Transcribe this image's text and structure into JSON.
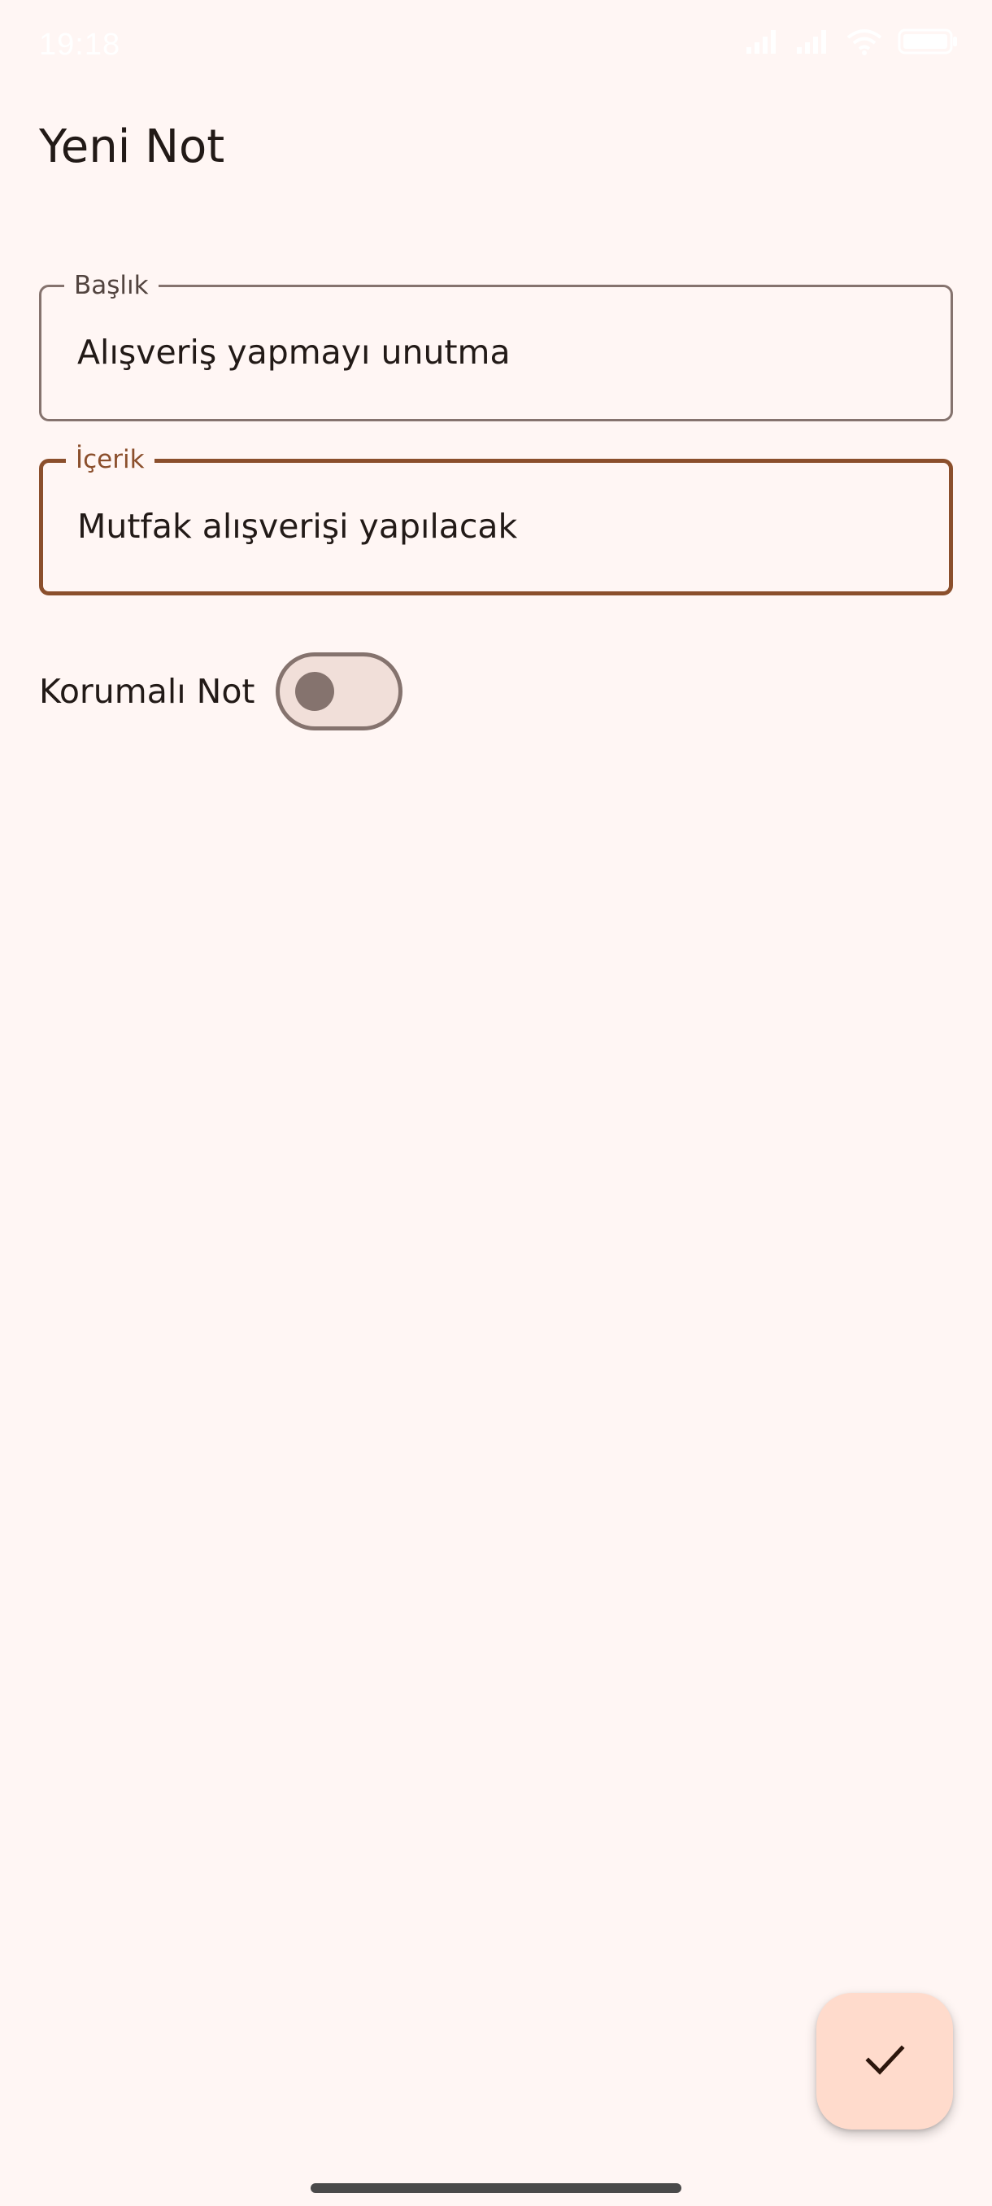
{
  "status_bar": {
    "time": "19:18",
    "icons": [
      "signal-icon",
      "signal-icon",
      "wifi-icon",
      "battery-icon"
    ]
  },
  "page": {
    "title": "Yeni Not"
  },
  "form": {
    "title_field": {
      "label": "Başlık",
      "value": "Alışveriş yapmayı unutma"
    },
    "content_field": {
      "label": "İçerik",
      "value": "Mutfak alışverişi yapılacak"
    },
    "protected_toggle": {
      "label": "Korumalı Not",
      "checked": false
    }
  },
  "fab": {
    "icon": "check-icon"
  },
  "colors": {
    "background": "#fff6f4",
    "primary": "#8b4f2c",
    "outline": "#85736e",
    "fab_container": "#ffdbcc",
    "switch_track": "#f1dfd9"
  }
}
